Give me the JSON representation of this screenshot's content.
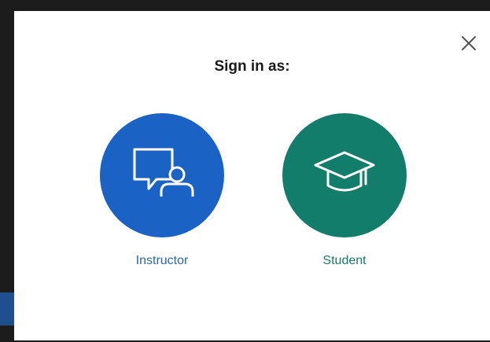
{
  "dialog": {
    "title": "Sign in as:",
    "close_icon": "close-icon"
  },
  "roles": [
    {
      "label": "Instructor",
      "icon": "presenter-chat-icon",
      "color": "#1a63c5",
      "label_color": "#2a65b0"
    },
    {
      "label": "Student",
      "icon": "graduation-cap-icon",
      "color": "#127d6a",
      "label_color": "#177a68"
    }
  ],
  "colors": {
    "dialog_bg": "#ffffff",
    "backdrop": "#1c1c1c"
  }
}
